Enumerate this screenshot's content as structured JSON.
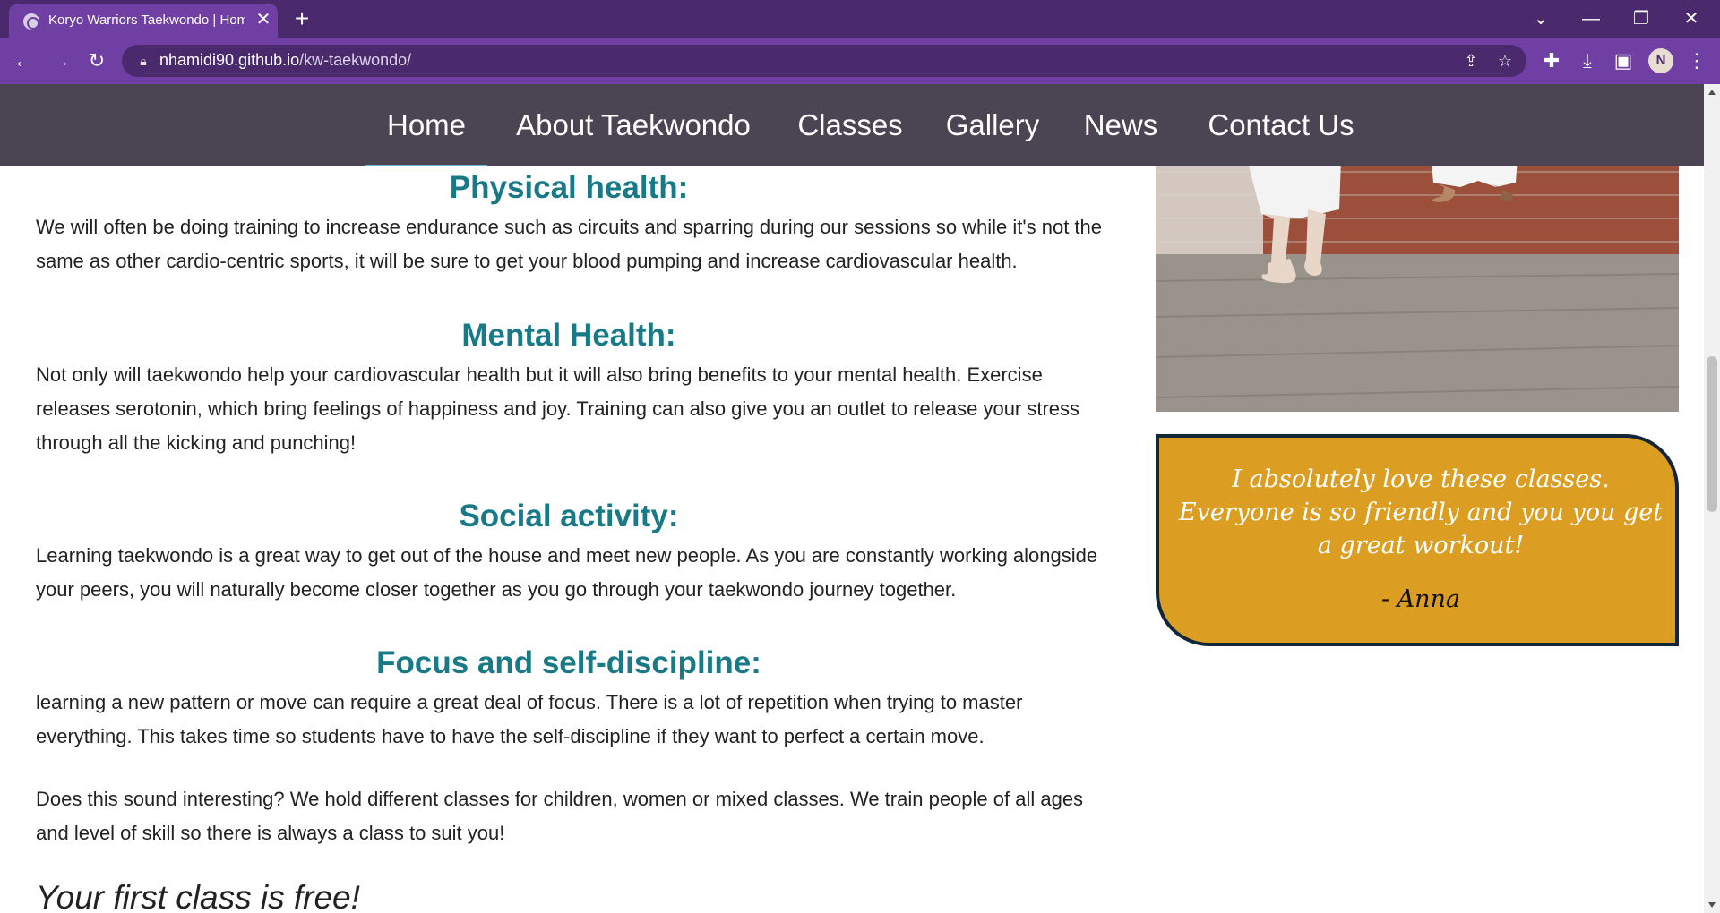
{
  "browser": {
    "tab_title": "Koryo Warriors Taekwondo | Home",
    "tab_close_icon": "✕",
    "new_tab_icon": "+",
    "url_host": "nhamidi90.github.io",
    "url_path": "/kw-taekwondo/",
    "profile_initial": "N",
    "window_buttons": [
      "⌄",
      "—",
      "❐",
      "✕"
    ],
    "theme_color": "#6f3fa3"
  },
  "nav": {
    "items": [
      "Home",
      "About Taekwondo",
      "Classes",
      "Gallery",
      "News",
      "Contact Us"
    ],
    "active": "Home",
    "background": "#4b4452"
  },
  "content": {
    "sections": [
      {
        "heading": "Physical health:",
        "body": "We will often be doing training to increase endurance such as circuits and sparring during our sessions so while it's not the same as other cardio-centric sports, it will be sure to get your blood pumping and increase cardiovascular health."
      },
      {
        "heading": "Mental Health:",
        "body": "Not only will taekwondo help your cardiovascular health but it will also bring benefits to your mental health. Exercise releases serotonin, which bring feelings of happiness and joy. Training can also give you an outlet to release your stress through all the kicking and punching!"
      },
      {
        "heading": "Social activity:",
        "body": "Learning taekwondo is a great way to get out of the house and meet new people. As you are constantly working alongside your peers, you will naturally become closer together as you go through your taekwondo journey together."
      },
      {
        "heading": "Focus and self-discipline:",
        "body": "learning a new pattern or move can require a great deal of focus. There is a lot of repetition when trying to master everything. This takes time so students have to have the self-discipline if they want to perfect a certain move."
      }
    ],
    "closing": "Does this sound interesting? We hold different classes for children, women or mixed classes. We train people of all ages and level of skill so there is always a class to suit you!",
    "cta": "Your first class is free!",
    "heading_color": "#187a86"
  },
  "sidebar": {
    "testimonial_quote": "I absolutely love these classes. Everyone is so friendly and you you get a great workout!",
    "testimonial_author": "- Anna",
    "testimonial_color": "#dc9e22"
  }
}
